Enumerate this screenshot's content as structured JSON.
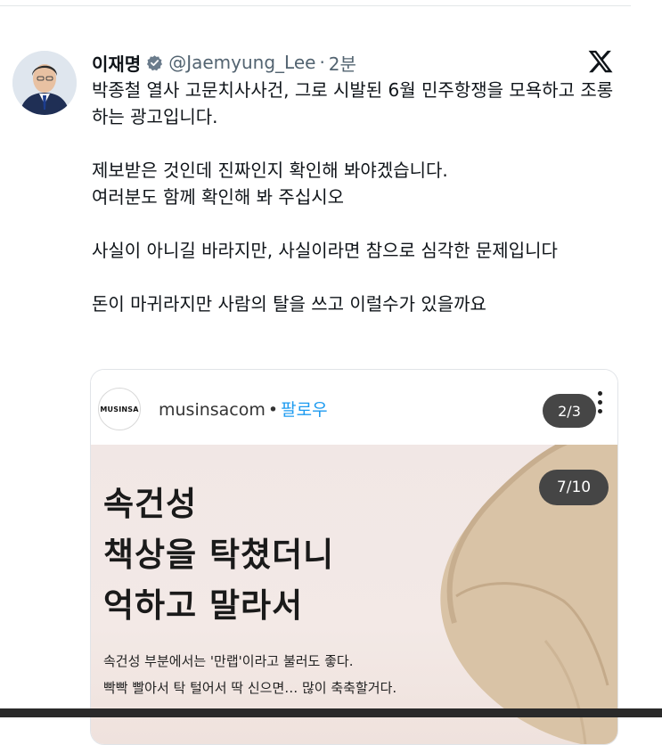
{
  "tweet": {
    "author_name": "이재명",
    "handle": "@Jaemyung_Lee",
    "separator": "·",
    "time": "2분",
    "paragraphs": [
      "박종철 열사 고문치사사건, 그로 시발된 6월 민주항쟁을 모욕하고 조롱하는 광고입니다.",
      "제보받은 것인데 진짜인지 확인해 봐야겠습니다.",
      "여러분도 함께 확인해 봐 주십시오",
      "사실이 아니길 바라지만, 사실이라면 참으로 심각한 문제입니다",
      "돈이 마귀라지만 사람의 탈을 쓰고 이럴수가 있을까요"
    ]
  },
  "icons": {
    "verified": "verified-badge-icon",
    "platform": "x-logo-icon",
    "more": "more-vertical-icon"
  },
  "card": {
    "brand_logo_text": "MUSINSA",
    "account": "musinsacom",
    "dot": "•",
    "follow": "팔로우",
    "page_indicator": "2/3",
    "ad": {
      "slide_indicator": "7/10",
      "headline": [
        "속건성",
        "책상을 탁쳤더니",
        "억하고 말라서"
      ],
      "desc": [
        "속건성 부분에서는 '만랩'이라고 불러도 좋다.",
        "빡빡 빨아서 탁 털어서 딱 신으면… 많이 축축할거다."
      ]
    }
  },
  "colors": {
    "text": "#0f1419",
    "secondary": "#536471",
    "link": "#1d9bf0",
    "ad_background": "#f1e7e5"
  }
}
